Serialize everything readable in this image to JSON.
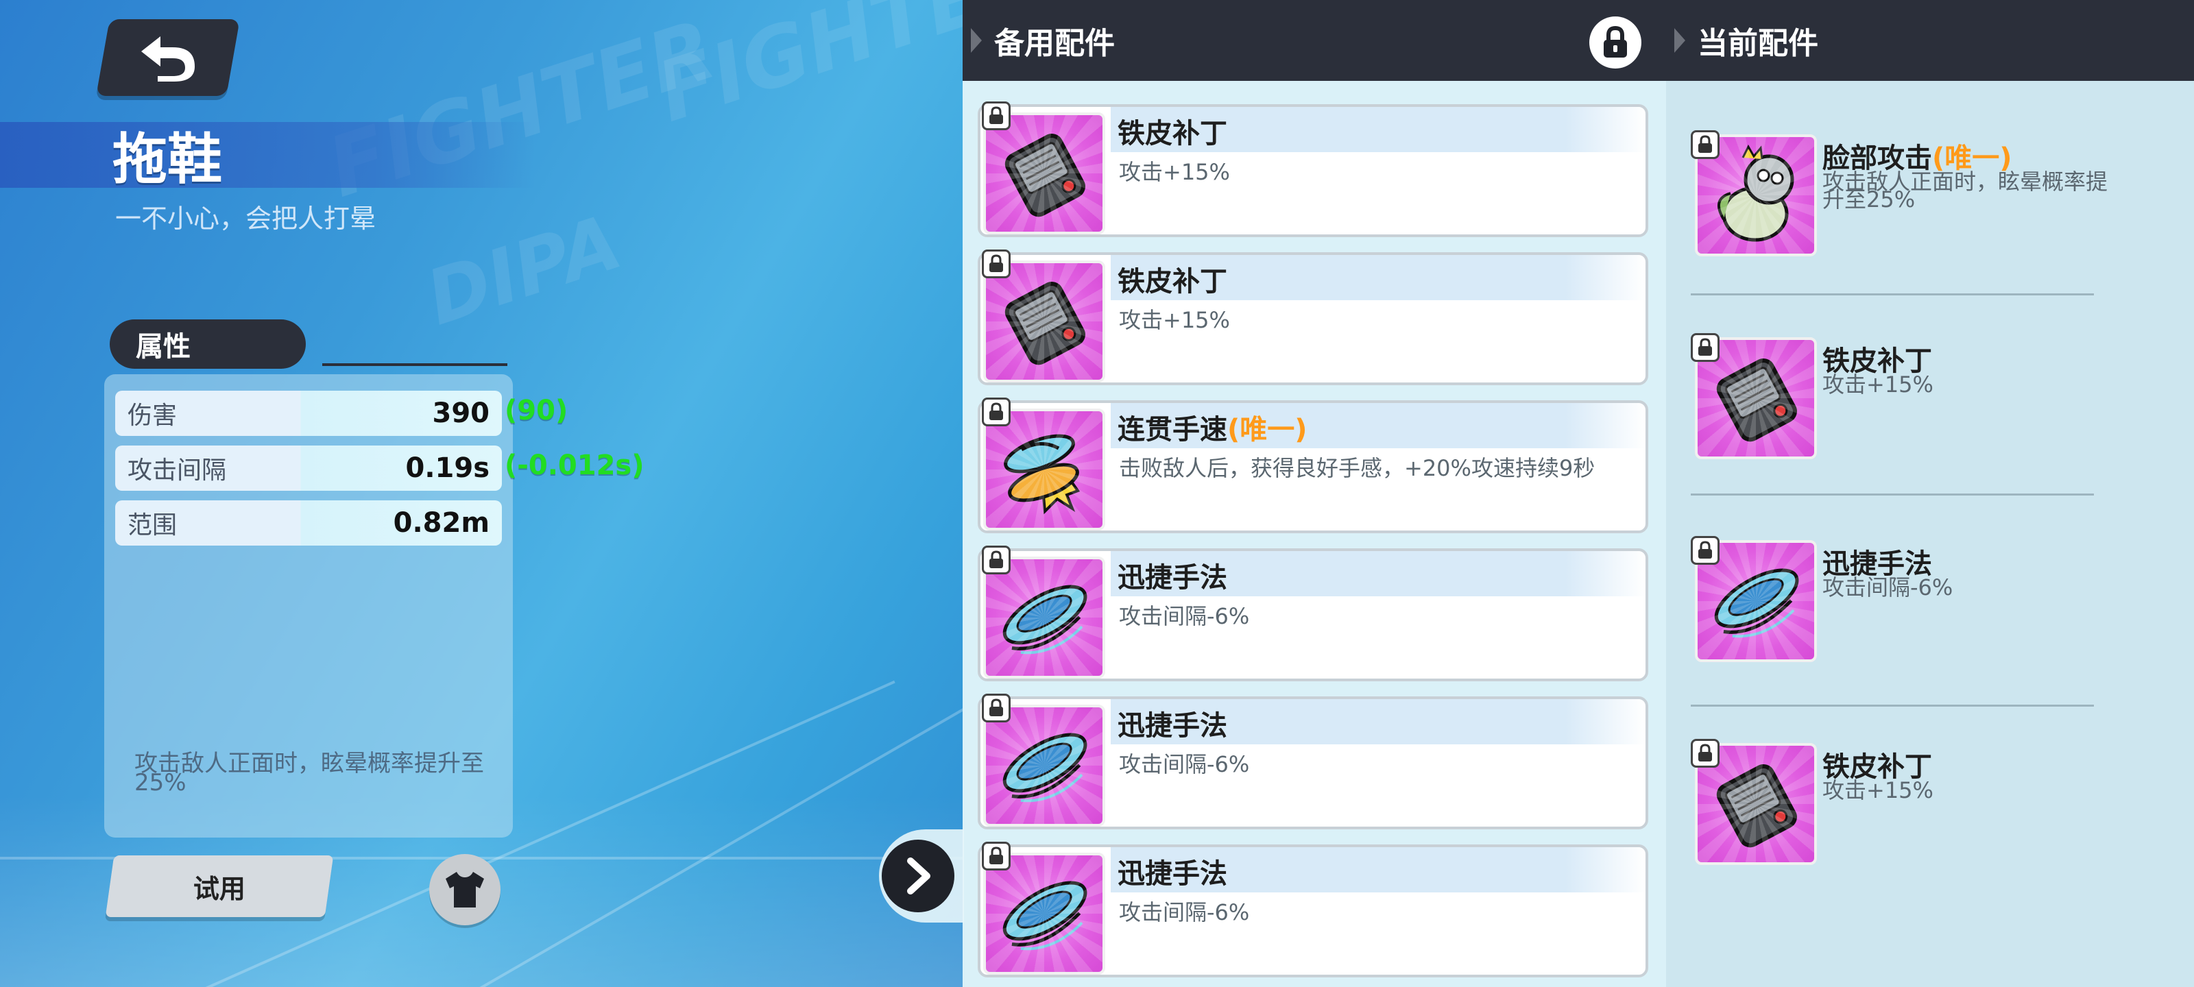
{
  "weapon": {
    "name": "拖鞋",
    "description": "一不小心，会把人打晕"
  },
  "attributes": {
    "tab_label": "属性",
    "stats": [
      {
        "label": "伤害",
        "value": "390",
        "delta": "(90)"
      },
      {
        "label": "攻击间隔",
        "value": "0.19s",
        "delta": "(-0.012s)"
      },
      {
        "label": "范围",
        "value": "0.82m",
        "delta": ""
      }
    ],
    "note": "攻击敌人正面时，眩晕概率提升至25%"
  },
  "buttons": {
    "try_label": "试用"
  },
  "background": {
    "watermarks": [
      "FIGHTER",
      "DIPA"
    ]
  },
  "spare": {
    "title": "备用配件",
    "cards": [
      {
        "name": "铁皮补丁",
        "unique": "",
        "desc": "攻击+15%",
        "icon": "metal-patch-icon"
      },
      {
        "name": "铁皮补丁",
        "unique": "",
        "desc": "攻击+15%",
        "icon": "metal-patch-icon"
      },
      {
        "name": "连贯手速",
        "unique": "(唯一)",
        "desc": "击败敌人后，获得良好手感，+20%攻速持续9秒",
        "icon": "slippers-icon"
      },
      {
        "name": "迅捷手法",
        "unique": "",
        "desc": "攻击间隔-6%",
        "icon": "swift-disc-icon"
      },
      {
        "name": "迅捷手法",
        "unique": "",
        "desc": "攻击间隔-6%",
        "icon": "swift-disc-icon"
      },
      {
        "name": "迅捷手法",
        "unique": "",
        "desc": "攻击间隔-6%",
        "icon": "swift-disc-icon"
      }
    ]
  },
  "current": {
    "title": "当前配件",
    "items": [
      {
        "name": "脸部攻击",
        "unique": "(唯一)",
        "desc": "攻击敌人正面时，眩晕概率提升至25%",
        "icon": "face-attack-icon"
      },
      {
        "name": "铁皮补丁",
        "unique": "",
        "desc": "攻击+15%",
        "icon": "metal-patch-icon"
      },
      {
        "name": "迅捷手法",
        "unique": "",
        "desc": "攻击间隔-6%",
        "icon": "swift-disc-icon"
      },
      {
        "name": "铁皮补丁",
        "unique": "",
        "desc": "攻击+15%",
        "icon": "metal-patch-icon"
      }
    ]
  },
  "colors": {
    "accent_unique": "#ff9a1a",
    "delta_green": "#22dd22",
    "header_dark": "#2b2f3a",
    "icon_bg_magenta": "#e05de0"
  }
}
